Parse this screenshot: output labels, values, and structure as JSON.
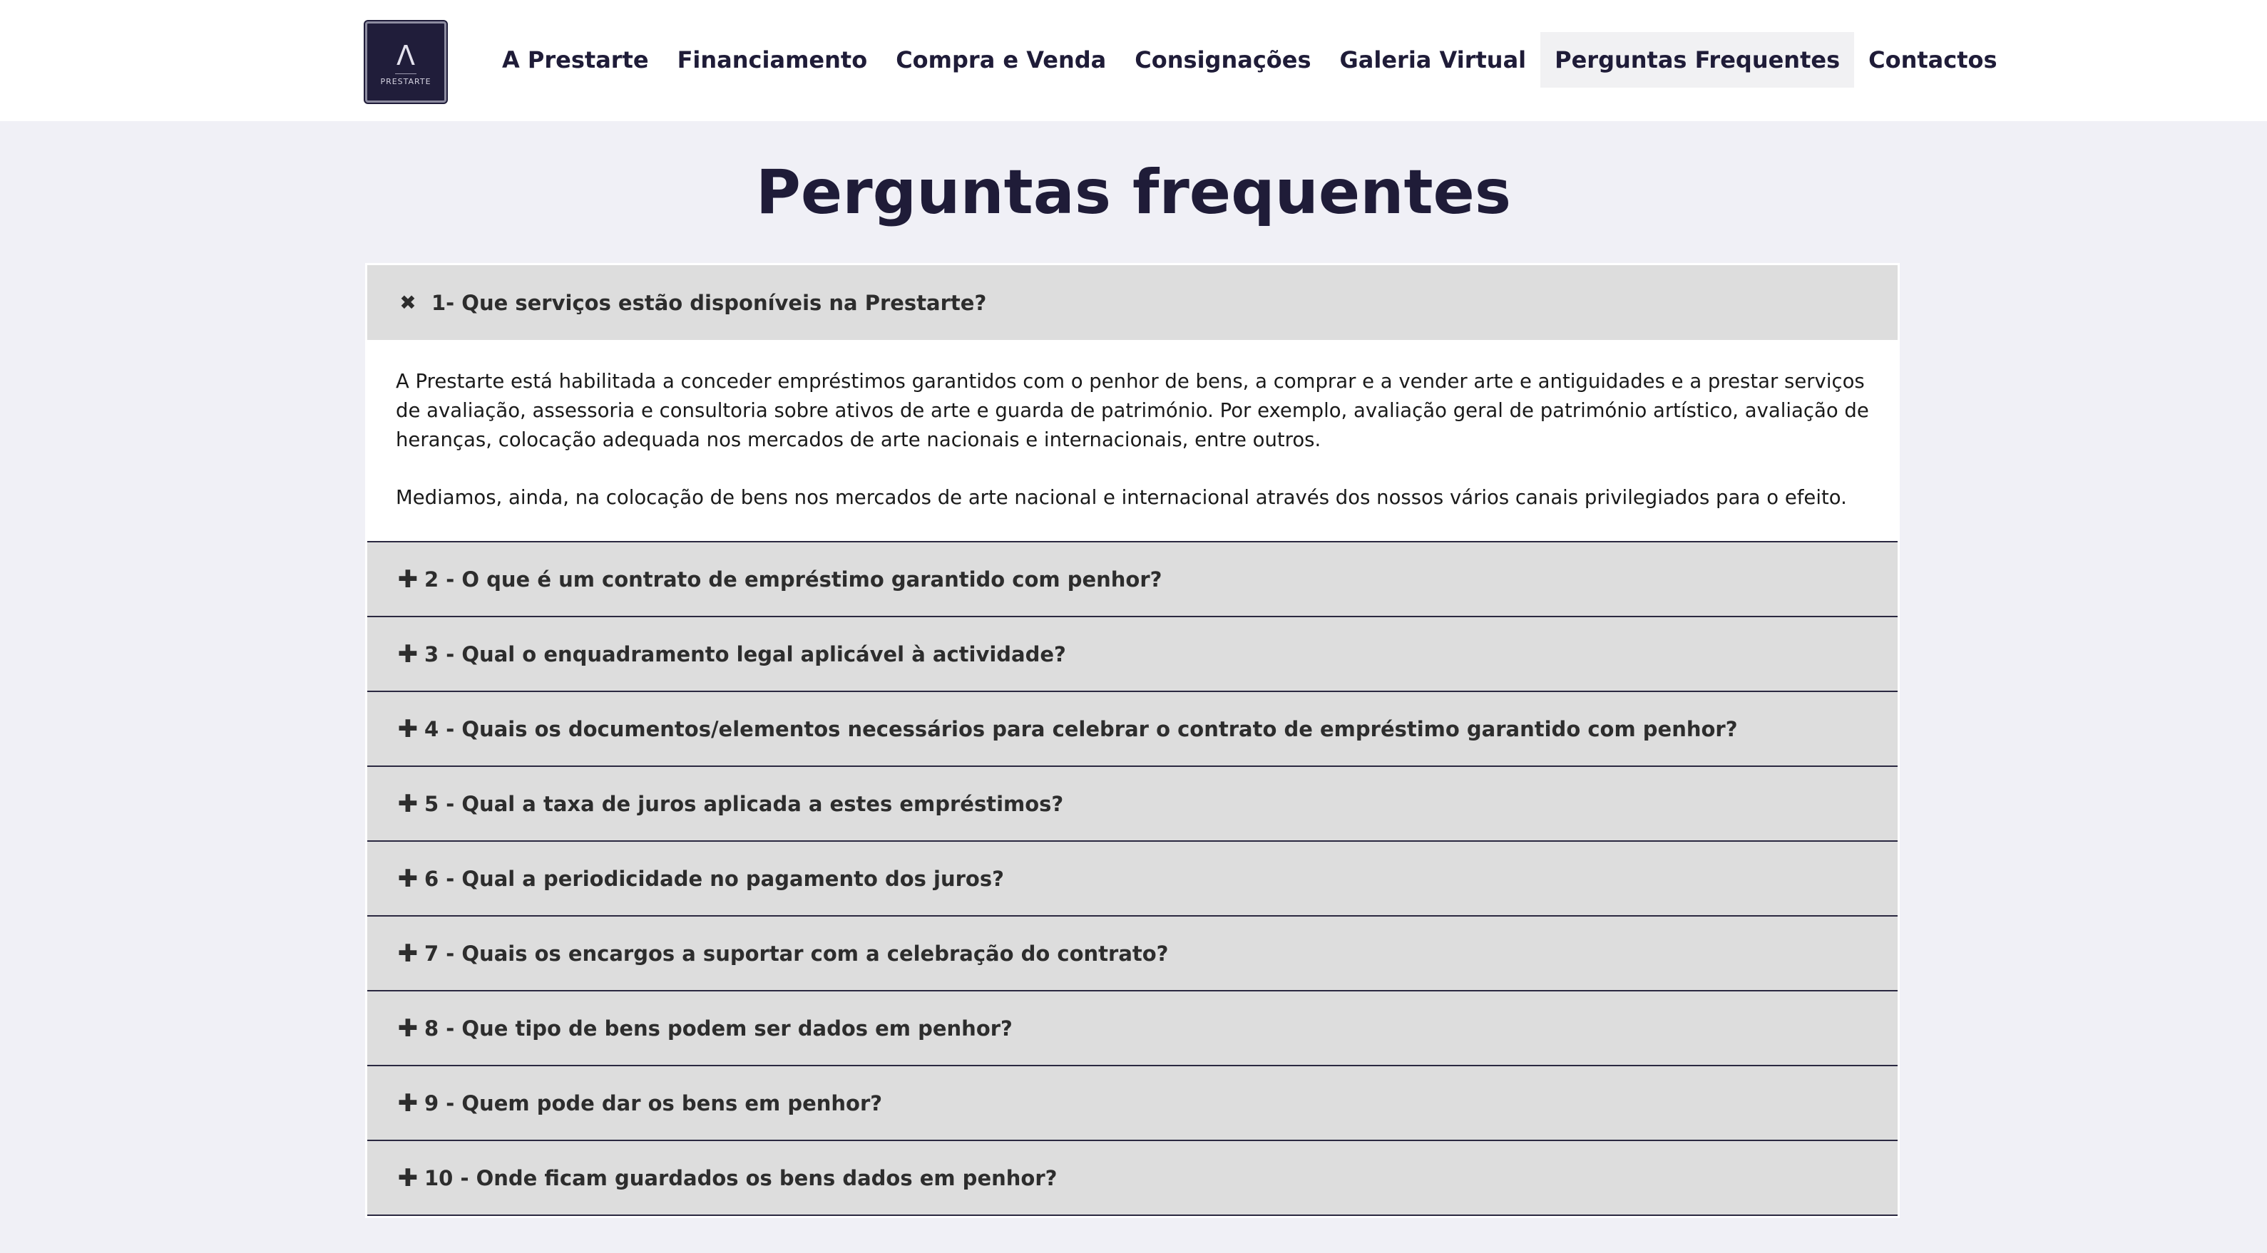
{
  "logo": {
    "mark": "Λ",
    "text": "PRESTARTE"
  },
  "nav": {
    "items": [
      {
        "label": "A Prestarte",
        "active": false
      },
      {
        "label": "Financiamento",
        "active": false
      },
      {
        "label": "Compra e Venda",
        "active": false
      },
      {
        "label": "Consignações",
        "active": false
      },
      {
        "label": "Galeria Virtual",
        "active": false
      },
      {
        "label": "Perguntas Frequentes",
        "active": true
      },
      {
        "label": "Contactos",
        "active": false
      }
    ]
  },
  "page": {
    "title": "Perguntas frequentes"
  },
  "faq": {
    "open_icon": "✖",
    "closed_icon": "✚",
    "items": [
      {
        "question": "1- Que serviços estão disponíveis na Prestarte?",
        "open": true,
        "answer": [
          "A Prestarte está habilitada a conceder empréstimos garantidos com o penhor de bens, a comprar e a vender arte e antiguidades e a prestar serviços de avaliação, assessoria e consultoria sobre ativos de arte e guarda de património. Por exemplo, avaliação geral de património artístico, avaliação de heranças, colocação adequada nos mercados de arte nacionais e internacionais, entre outros.",
          "Mediamos, ainda, na colocação de bens nos mercados de arte nacional e internacional através dos nossos vários canais privilegiados para o efeito."
        ]
      },
      {
        "question": " 2 - O que é um contrato de empréstimo garantido com penhor?",
        "open": false
      },
      {
        "question": "3 - Qual o enquadramento legal aplicável à actividade?",
        "open": false
      },
      {
        "question": "4 - Quais os documentos/elementos necessários para celebrar o contrato de empréstimo garantido com penhor?",
        "open": false
      },
      {
        "question": "5 - Qual a taxa de juros aplicada a estes empréstimos?",
        "open": false
      },
      {
        "question": "6 - Qual a periodicidade no pagamento dos juros?",
        "open": false
      },
      {
        "question": "7 - Quais os encargos a suportar com a celebração do contrato?",
        "open": false
      },
      {
        "question": "8 - Que tipo de bens podem ser dados em penhor?",
        "open": false
      },
      {
        "question": "9 - Quem pode dar os bens em penhor?",
        "open": false
      },
      {
        "question": "10 - Onde ficam guardados os bens dados em penhor?",
        "open": false
      }
    ]
  }
}
